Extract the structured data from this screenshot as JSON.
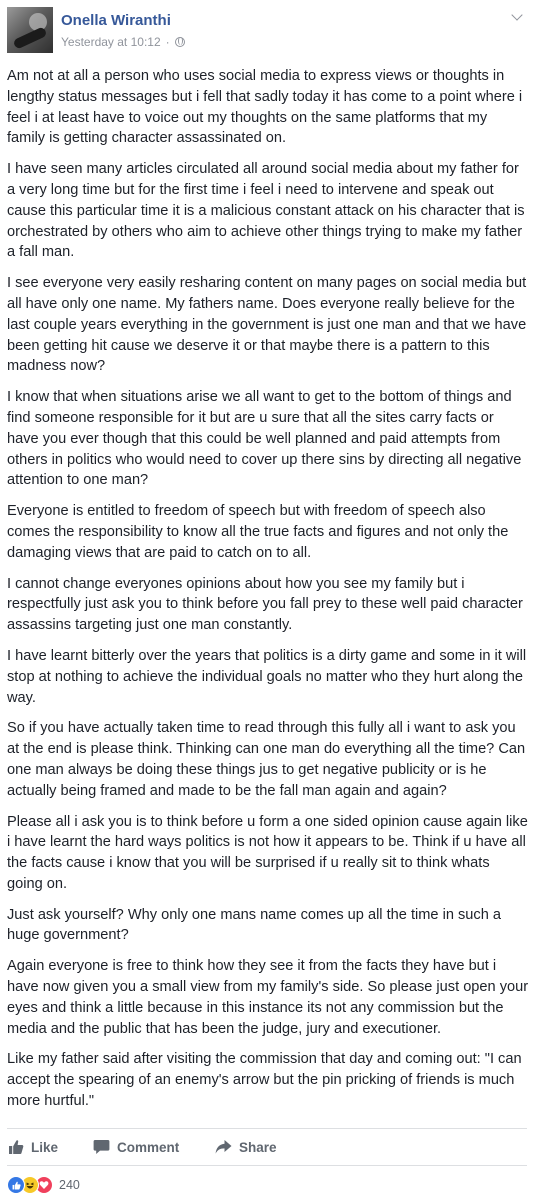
{
  "author": {
    "name": "Onella Wiranthi",
    "timestamp": "Yesterday at 10:12",
    "separator": "·",
    "privacy_icon": "globe-icon"
  },
  "post": {
    "paragraphs": [
      "Am not at all a person who uses social media to express views or thoughts in lengthy status messages but i fell that sadly today it has come to a point where i feel i at least have to voice out my thoughts on the same platforms that my family is getting character assassinated on.",
      "I have seen many articles circulated all around social media about my father for a very long time but for the first time i feel i need to intervene and speak out cause this particular time it is a malicious constant attack on his character that is orchestrated by others who aim to achieve other things trying to make my father a fall man.",
      "I see everyone very easily resharing content on many pages on social media but all have only one name. My fathers name. Does everyone really believe for the last couple years everything in the government is just one man and that we have been getting hit cause we deserve it or that maybe there is a pattern to this madness now?",
      "I know that when situations arise we all want to get to the bottom of things and find someone responsible for it but are u sure that all the sites carry facts or have you ever though that this could be well planned and paid attempts from others in politics who would need to cover up there sins by directing all negative attention to one man?",
      "Everyone is entitled to freedom of speech but with freedom of speech also comes the responsibility to know all the true facts and figures and not only the damaging views that are paid to catch on to all.",
      "I cannot change everyones opinions about how you see my family but i respectfully just ask you to think before you fall prey to these well paid character assassins targeting just one man constantly.",
      "I have learnt bitterly over the years that politics is a dirty game and some in it will stop at nothing to achieve the individual goals no matter who they hurt along the way.",
      "So if you have actually taken time to read through this fully all i want to ask you at the end is please think. Thinking can one man do everything all the time? Can one man always be doing these things jus to get negative publicity or is he actually being framed and made to be the fall man again and again?",
      "Please all i ask you is to think before u form a one sided opinion cause again like i have learnt the hard ways politics is not how it appears to be. Think if u have all the facts cause i know that you will be surprised if u really sit to think whats going on.",
      "Just ask yourself? Why only one mans name comes up all the time in such a huge government?",
      "Again everyone is free to think how they see it from the facts they have but i have now given you a small view from my family's side. So please just open your eyes and think a little because in this instance its not any commission but the media and the public that has been the judge, jury and executioner.",
      "Like my father said after visiting the commission that day and coming out: \"I can accept the spearing of an enemy's arrow but the pin pricking of friends is much more hurtful.\""
    ]
  },
  "actions": {
    "like": "Like",
    "comment": "Comment",
    "share": "Share"
  },
  "reactions": {
    "count": "240",
    "types": [
      "like",
      "haha",
      "love"
    ]
  },
  "colors": {
    "name": "#365899",
    "text": "#1d2129",
    "meta": "#90949c",
    "action": "#606770",
    "like": "#3578e5",
    "haha": "#f7c928",
    "love": "#f0405c"
  }
}
